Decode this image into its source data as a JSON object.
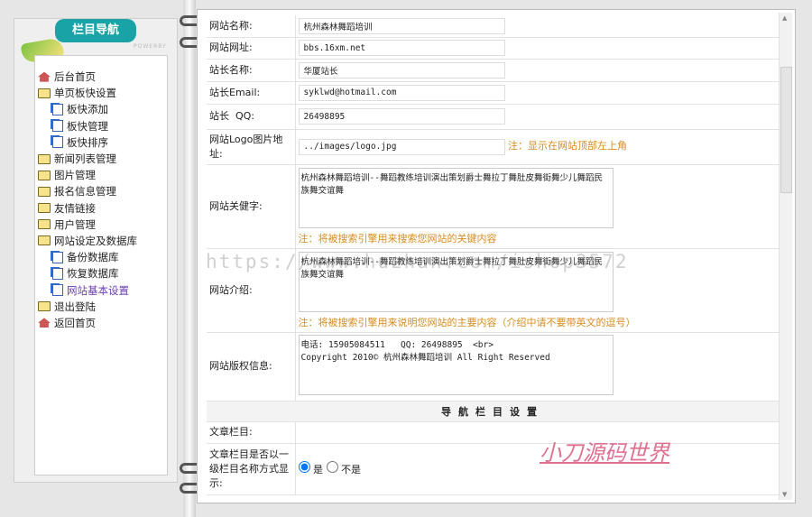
{
  "sidebar": {
    "title": "栏目导航",
    "subtitle": "POWERBY",
    "items": [
      {
        "label": "后台首页",
        "icon": "home-icon",
        "level": 0
      },
      {
        "label": "单页板快设置",
        "icon": "folder-open-icon",
        "level": 0
      },
      {
        "label": "板快添加",
        "icon": "page-icon",
        "level": 1
      },
      {
        "label": "板快管理",
        "icon": "page-icon",
        "level": 1
      },
      {
        "label": "板快排序",
        "icon": "page-icon",
        "level": 1
      },
      {
        "label": "新闻列表管理",
        "icon": "folder-icon",
        "level": 0
      },
      {
        "label": "图片管理",
        "icon": "folder-icon",
        "level": 0
      },
      {
        "label": "报名信息管理",
        "icon": "folder-icon",
        "level": 0
      },
      {
        "label": "友情链接",
        "icon": "folder-icon",
        "level": 0
      },
      {
        "label": "用户管理",
        "icon": "folder-icon",
        "level": 0
      },
      {
        "label": "网站设定及数据库",
        "icon": "folder-open-icon",
        "level": 0
      },
      {
        "label": "备份数据库",
        "icon": "page-icon",
        "level": 1
      },
      {
        "label": "恢复数据库",
        "icon": "page-icon",
        "level": 1
      },
      {
        "label": "网站基本设置",
        "icon": "page-icon",
        "level": 1,
        "active": true
      },
      {
        "label": "退出登陆",
        "icon": "folder-icon",
        "level": 0
      },
      {
        "label": "返回首页",
        "icon": "home-icon",
        "level": 0
      }
    ]
  },
  "form": {
    "site_name": {
      "label": "网站名称:",
      "value": "杭州森林舞蹈培训"
    },
    "site_url": {
      "label": "网站网址:",
      "value": "bbs.16xm.net"
    },
    "admin_name": {
      "label": "站长名称:",
      "value": "华厦站长"
    },
    "admin_email": {
      "label": "站长Email:",
      "value": "syklwd@hotmail.com"
    },
    "admin_qq": {
      "label": "站长  QQ:",
      "value": "26498895"
    },
    "logo": {
      "label": "网站Logo图片地址:",
      "value": "../images/logo.jpg",
      "note": "注：显示在网站顶部左上角"
    },
    "keywords": {
      "label": "网站关健字:",
      "value": "杭州森林舞蹈培训--舞蹈教练培训演出策划爵士舞拉丁舞肚皮舞街舞少儿舞蹈民族舞交谊舞",
      "note": "注：将被搜索引擎用来搜索您网站的关键内容"
    },
    "intro": {
      "label": "网站介绍:",
      "value": "杭州森林舞蹈培训--舞蹈教练培训演出策划爵士舞拉丁舞肚皮舞街舞少儿舞蹈民族舞交谊舞",
      "note": "注：将被搜索引擎用来说明您网站的主要内容（介绍中请不要带英文的逗号）"
    },
    "copyright": {
      "label": "网站版权信息:",
      "value": "电话: 15905084511   QQ: 26498895  <br>\nCopyright 2010© 杭州森林舞蹈培训 All Right Reserved"
    },
    "nav_section": "导航栏目设置",
    "article_column": {
      "label": "文章栏目:"
    },
    "first_level": {
      "label": "文章栏目是否以一级栏目名称方式显示:",
      "yes": "是",
      "no": "不是",
      "selected": "yes"
    }
  },
  "watermark": "https://www.huzhan.com/ishop3572",
  "signature": "小刀源码世界"
}
